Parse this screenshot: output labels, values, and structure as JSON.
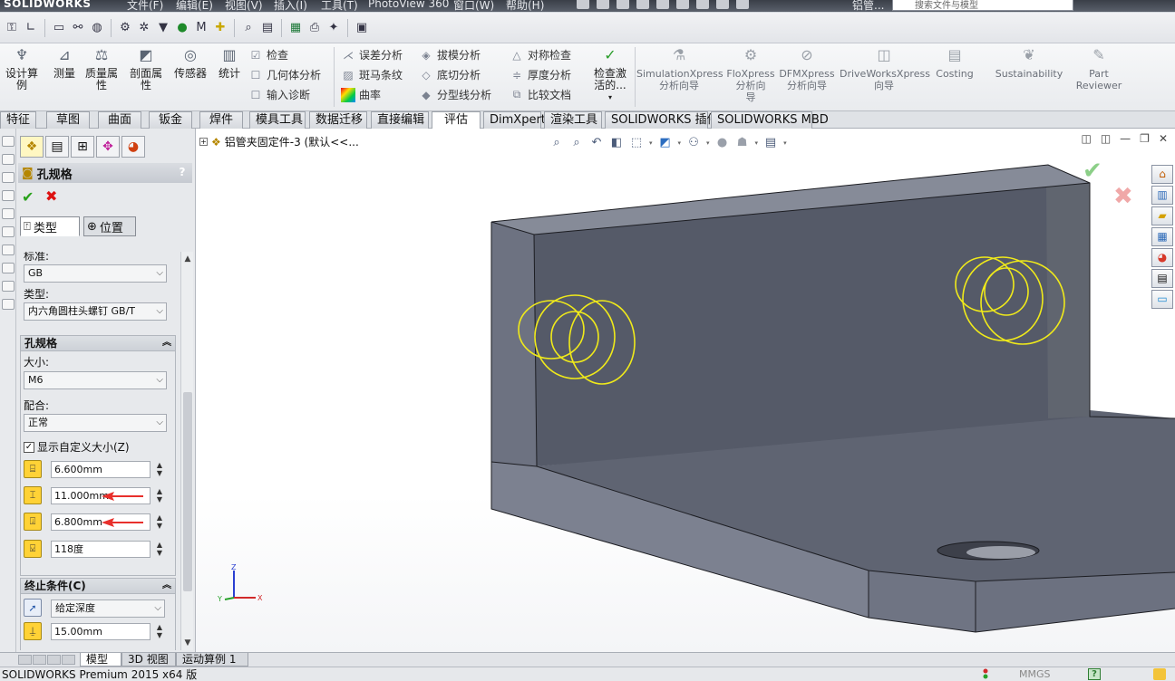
{
  "app": {
    "logo": "SOLIDWORKS",
    "menus": [
      "文件(F)",
      "编辑(E)",
      "视图(V)",
      "插入(I)",
      "工具(T)",
      "PhotoView 360",
      "窗口(W)",
      "帮助(H)"
    ],
    "doc_short": "铝管...",
    "search_placeholder": "搜索文件与模型"
  },
  "command_manager": {
    "left_buttons": [
      {
        "label": "设计算\n例",
        "icon": "design-study-icon"
      },
      {
        "label": "测量",
        "icon": "measure-icon"
      },
      {
        "label": "质量属\n性",
        "icon": "mass-properties-icon"
      },
      {
        "label": "剖面属\n性",
        "icon": "section-properties-icon"
      },
      {
        "label": "传感器",
        "icon": "sensor-icon"
      },
      {
        "label": "统计",
        "icon": "statistics-icon"
      }
    ],
    "check_column": [
      "检查",
      "几何体分析",
      "输入诊断"
    ],
    "analysis_column": [
      "误差分析",
      "斑马条纹",
      "曲率"
    ],
    "draft_column": [
      "拔模分析",
      "底切分析",
      "分型线分析"
    ],
    "symmetry_column": [
      "对称检查",
      "厚度分析",
      "比较文档"
    ],
    "check_active": "检查激\n活的...",
    "xpress_buttons": [
      {
        "label": "SimulationXpress\n分析向导"
      },
      {
        "label": "FloXpress\n分析向\n导"
      },
      {
        "label": "DFMXpress\n分析向导"
      },
      {
        "label": "DriveWorksXpress\n向导"
      },
      {
        "label": "Costing"
      },
      {
        "label": "Sustainability"
      },
      {
        "label": "Part\nReviewer"
      }
    ]
  },
  "tabs": [
    "特征",
    "草图",
    "曲面",
    "钣金",
    "焊件",
    "模具工具",
    "数据迁移",
    "直接编辑",
    "评估",
    "DimXpert",
    "渲染工具",
    "SOLIDWORKS 插件",
    "SOLIDWORKS MBD"
  ],
  "active_tab": "评估",
  "property_manager": {
    "title": "孔规格",
    "help": "?",
    "subtabs": [
      "类型",
      "位置"
    ],
    "standard_label": "标准:",
    "standard_value": "GB",
    "type_label": "类型:",
    "type_value": "内六角圆柱头螺钉 GB/T",
    "group_title": "孔规格",
    "size_label": "大小:",
    "size_value": "M6",
    "fit_label": "配合:",
    "fit_value": "正常",
    "custom_size_label": "显示自定义大小(Z)",
    "custom_size_checked": true,
    "dimensions": [
      "6.600mm",
      "11.000mm",
      "6.800mm",
      "118度"
    ],
    "highlighted_dimensions": [
      "11.000mm",
      "6.800mm"
    ],
    "end_condition_title": "终止条件(C)",
    "end_condition_value": "给定深度",
    "depth_value": "15.00mm"
  },
  "graphics": {
    "tree_label": "铝管夹固定件-3  (默认<<...",
    "triad": {
      "x": "X",
      "y": "Y",
      "z": "Z"
    }
  },
  "bottom_tabs": [
    "模型",
    "3D 视图",
    "运动算例 1"
  ],
  "active_bottom_tab": "模型",
  "status": {
    "product": "SOLIDWORKS Premium 2015 x64 版",
    "units": "MMGS",
    "help": "?"
  },
  "colors": {
    "part_face": "#5c6170",
    "part_dark": "#474b57",
    "hole_preview": "#f0ea1a",
    "callout_arrow": "#e8302c"
  }
}
